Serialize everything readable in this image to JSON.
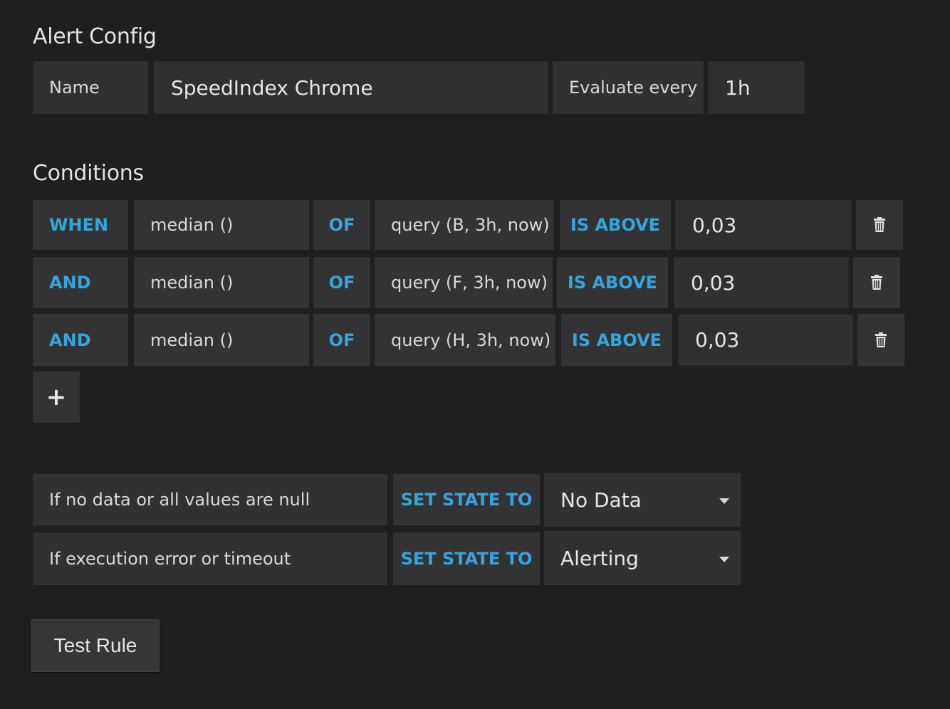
{
  "alert_config": {
    "title": "Alert Config",
    "name_label": "Name",
    "name_value": "SpeedIndex  Chrome",
    "evaluate_label": "Evaluate every",
    "evaluate_value": "1h"
  },
  "conditions": {
    "title": "Conditions",
    "rows": [
      {
        "operator": "WHEN",
        "reducer": "median ()",
        "of": "OF",
        "query": "query (B, 3h, now)",
        "evaluator": "IS ABOVE",
        "threshold": "0,03"
      },
      {
        "operator": "AND",
        "reducer": "median ()",
        "of": "OF",
        "query": "query (F, 3h, now)",
        "evaluator": "IS ABOVE",
        "threshold": "0,03"
      },
      {
        "operator": "AND",
        "reducer": "median ()",
        "of": "OF",
        "query": "query (H, 3h, now)",
        "evaluator": "IS ABOVE",
        "threshold": "0,03"
      }
    ],
    "add_label": "+"
  },
  "state_rules": [
    {
      "condition": "If no data or all values are null",
      "set_label": "SET STATE TO",
      "value": "No Data"
    },
    {
      "condition": "If execution error or timeout",
      "set_label": "SET STATE TO",
      "value": "Alerting"
    }
  ],
  "test_rule_label": "Test Rule",
  "colors": {
    "accent": "#33a6de",
    "background": "#1f1f20",
    "cell": "#333334"
  },
  "icons": {
    "delete": "trash-icon",
    "dropdown": "caret-down-icon"
  }
}
